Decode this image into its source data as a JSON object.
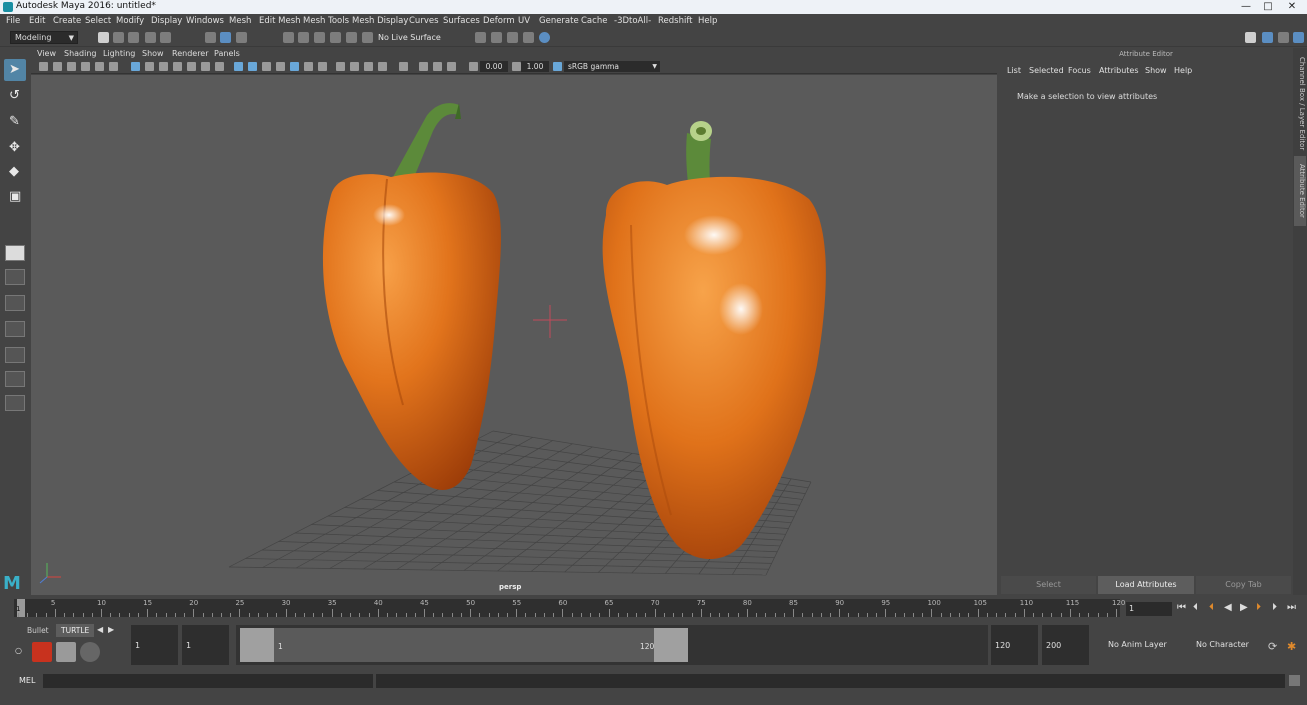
{
  "window": {
    "title": "Autodesk Maya 2016: untitled*",
    "controls": [
      "—",
      "□",
      "✕"
    ]
  },
  "menu": [
    "File",
    "Edit",
    "Create",
    "Select",
    "Modify",
    "Display",
    "Windows",
    "Mesh",
    "Edit Mesh",
    "Mesh Tools",
    "Mesh Display",
    "Curves",
    "Surfaces",
    "Deform",
    "UV",
    "Generate",
    "Cache",
    "-3DtoAll-",
    "Redshift",
    "Help"
  ],
  "status_line": {
    "mode": "Modeling",
    "live_surface": "No Live Surface"
  },
  "viewport": {
    "menu": [
      "View",
      "Shading",
      "Lighting",
      "Show",
      "Renderer",
      "Panels"
    ],
    "exposure": "0.00",
    "gamma": "1.00",
    "color_space": "sRGB gamma",
    "camera": "persp"
  },
  "attribute_editor": {
    "title": "Attribute Editor",
    "menu": [
      "List",
      "Selected",
      "Focus",
      "Attributes",
      "Show",
      "Help"
    ],
    "message": "Make a selection to view attributes",
    "footer": [
      "Select",
      "Load Attributes",
      "Copy Tab"
    ]
  },
  "side_tabs": [
    "Channel Box / Layer Editor",
    "Attribute Editor"
  ],
  "timeline": {
    "ticks": [
      "5",
      "10",
      "15",
      "20",
      "25",
      "30",
      "35",
      "40",
      "45",
      "50",
      "55",
      "60",
      "65",
      "70",
      "75",
      "80",
      "85",
      "90",
      "95",
      "100",
      "105",
      "110",
      "115",
      "120"
    ],
    "current_frame_marker": "1",
    "current_time": "1"
  },
  "range": {
    "shelf_tabs": [
      "Bullet",
      "TURTLE"
    ],
    "start_time": "1",
    "playback_start": "1",
    "slider_start": "1",
    "slider_end": "120",
    "playback_end": "120",
    "end_time": "200",
    "anim_layer": "No Anim Layer",
    "character_set": "No Character Set"
  },
  "command_line": {
    "label": "MEL"
  },
  "colors": {
    "pepper_light": "#f08a2a",
    "pepper_dark": "#b84a0c",
    "stem": "#5c8a3a",
    "accent_blue": "#5285a6",
    "playback_orange": "#e08a2c"
  }
}
